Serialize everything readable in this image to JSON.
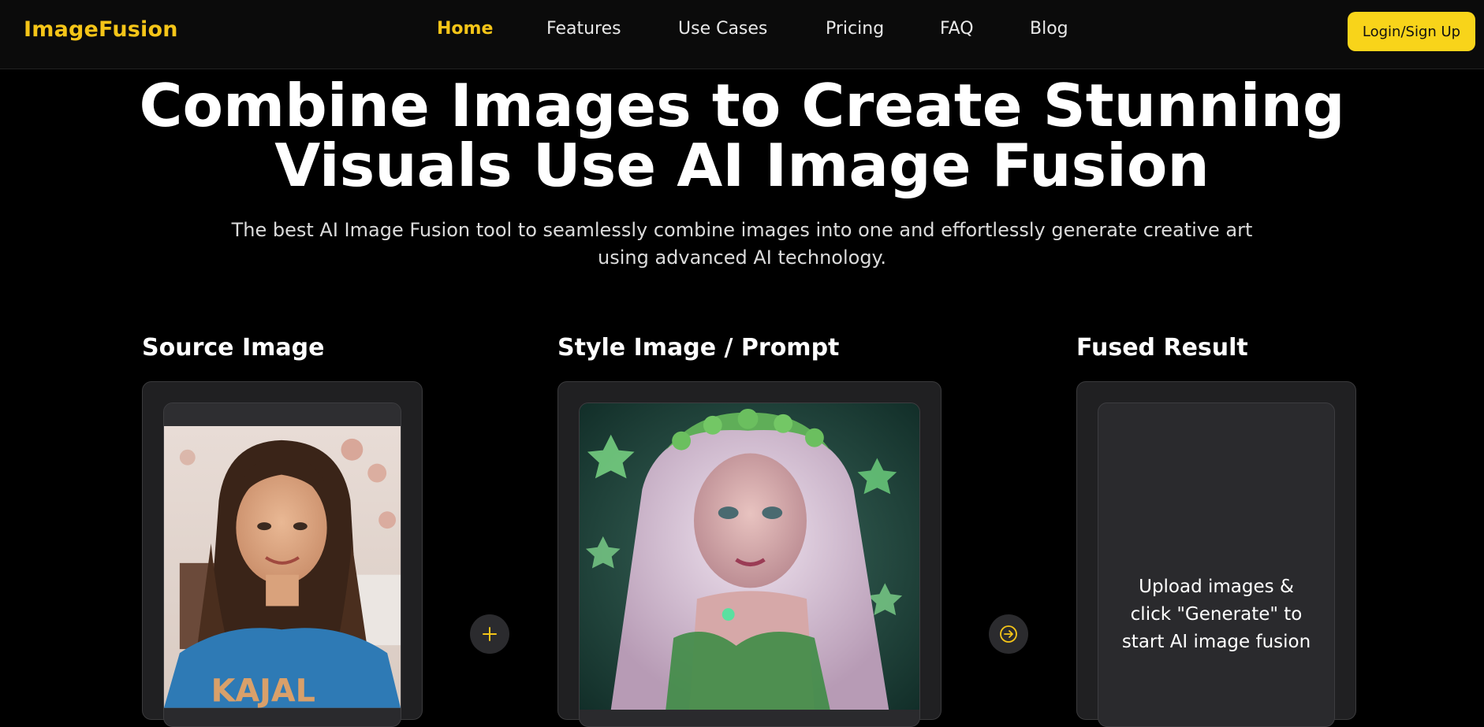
{
  "header": {
    "logo": "ImageFusion",
    "nav": [
      {
        "label": "Home",
        "active": true
      },
      {
        "label": "Features",
        "active": false
      },
      {
        "label": "Use Cases",
        "active": false
      },
      {
        "label": "Pricing",
        "active": false
      },
      {
        "label": "FAQ",
        "active": false
      },
      {
        "label": "Blog",
        "active": false
      }
    ],
    "login_label": "Login/Sign Up"
  },
  "hero": {
    "title_line1": "Combine Images to Create Stunning",
    "title_line2": "Visuals Use AI Image Fusion",
    "subtitle_line1": "The best AI Image Fusion tool to seamlessly combine images into one and effortlessly generate creative art",
    "subtitle_line2": "using advanced AI technology."
  },
  "columns": {
    "source_title": "Source Image",
    "style_title": "Style Image / Prompt",
    "result_title": "Fused Result",
    "result_placeholder_line1": "Upload images &",
    "result_placeholder_line2": "click \"Generate\" to",
    "result_placeholder_line3": "start AI image fusion"
  },
  "icons": {
    "add": "plus-icon",
    "next": "arrow-right-icon"
  },
  "colors": {
    "accent": "#f5c518",
    "button_bg": "#f8d41a",
    "background": "#000000",
    "card_bg": "#202022"
  }
}
